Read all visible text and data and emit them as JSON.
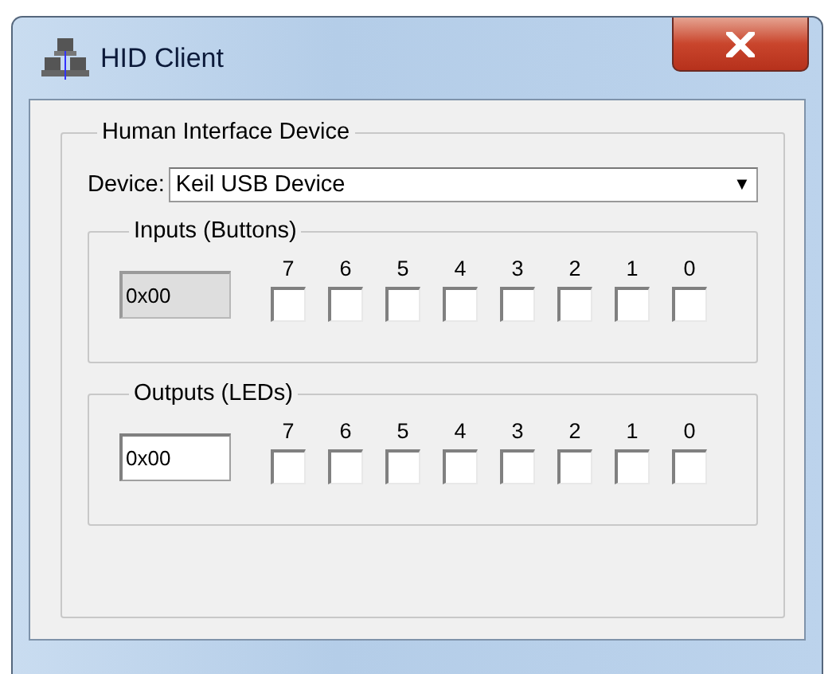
{
  "window": {
    "title": "HID Client"
  },
  "group": {
    "title": "Human Interface Device",
    "device_label": "Device:",
    "device_value": "Keil USB Device",
    "dropdown_arrow": "▼"
  },
  "sections": [
    {
      "title": "Inputs (Buttons)",
      "field": {
        "value": "0x00",
        "disabled": true
      },
      "bits": [
        {
          "label": "7",
          "checked": false
        },
        {
          "label": "6",
          "checked": false
        },
        {
          "label": "5",
          "checked": false
        },
        {
          "label": "4",
          "checked": false
        },
        {
          "label": "3",
          "checked": false
        },
        {
          "label": "2",
          "checked": false
        },
        {
          "label": "1",
          "checked": false
        },
        {
          "label": "0",
          "checked": false
        }
      ]
    },
    {
      "title": "Outputs (LEDs)",
      "field": {
        "value": "0x00",
        "disabled": false
      },
      "bits": [
        {
          "label": "7",
          "checked": false
        },
        {
          "label": "6",
          "checked": false
        },
        {
          "label": "5",
          "checked": false
        },
        {
          "label": "4",
          "checked": false
        },
        {
          "label": "3",
          "checked": false
        },
        {
          "label": "2",
          "checked": false
        },
        {
          "label": "1",
          "checked": false
        },
        {
          "label": "0",
          "checked": false
        }
      ]
    }
  ]
}
